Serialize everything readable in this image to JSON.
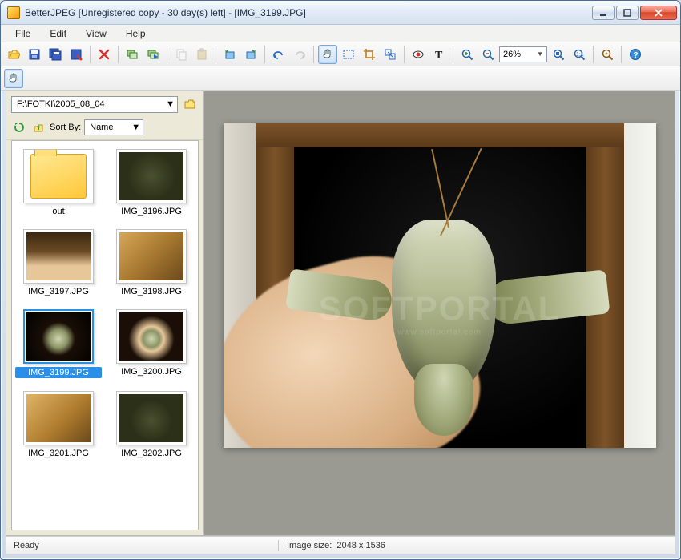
{
  "window": {
    "title": "BetterJPEG [Unregistered copy - 30 day(s) left] - [IMG_3199.JPG]"
  },
  "menu": {
    "file": "File",
    "edit": "Edit",
    "view": "View",
    "help": "Help"
  },
  "toolbar": {
    "zoom_value": "26%"
  },
  "sidebar": {
    "path": "F:\\FOTKI\\2005_08_04",
    "sort_label": "Sort By:",
    "sort_value": "Name",
    "items": [
      {
        "label": "out",
        "kind": "folder"
      },
      {
        "label": "IMG_3196.JPG",
        "kind": "image",
        "thumb": "th-3196"
      },
      {
        "label": "IMG_3197.JPG",
        "kind": "image",
        "thumb": "th-3197"
      },
      {
        "label": "IMG_3198.JPG",
        "kind": "image",
        "thumb": "th-3198"
      },
      {
        "label": "IMG_3199.JPG",
        "kind": "image",
        "thumb": "th-3199",
        "selected": true
      },
      {
        "label": "IMG_3200.JPG",
        "kind": "image",
        "thumb": "th-3200"
      },
      {
        "label": "IMG_3201.JPG",
        "kind": "image",
        "thumb": "th-3201"
      },
      {
        "label": "IMG_3202.JPG",
        "kind": "image",
        "thumb": "th-3202"
      }
    ]
  },
  "watermark": {
    "main": "SOFTPORTAL",
    "sub": "www.softportal.com"
  },
  "status": {
    "ready": "Ready",
    "imgsize_label": "Image size:",
    "imgsize_value": "2048 x 1536"
  }
}
